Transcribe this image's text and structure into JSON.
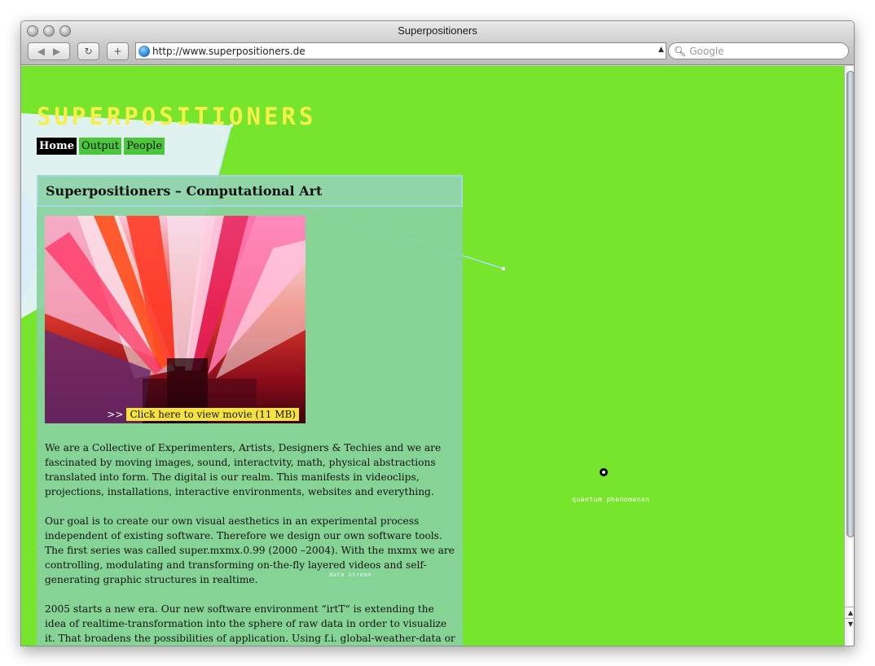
{
  "window": {
    "title": "Superpositioners"
  },
  "toolbar": {
    "back_icon": "back-arrow-icon",
    "forward_icon": "forward-arrow-icon",
    "reload_symbol": "↻",
    "add_symbol": "+",
    "url": "http://www.superpositioners.de",
    "search_placeholder": "Google"
  },
  "page": {
    "logo": "SUPERPOSITIONERS",
    "nav": [
      {
        "label": "Home",
        "active": true
      },
      {
        "label": "Output",
        "active": false
      },
      {
        "label": "People",
        "active": false
      }
    ],
    "panel_title": "Superpositioners – Computational Art",
    "movie_arrows": ">>",
    "movie_link": "Click here to view movie (11 MB)",
    "paragraphs": [
      "We are a Collective of Experimenters, Artists, Designers & Techies and we are fascinated by moving images, sound, interactvity, math, physical abstractions translated into form. The digital is our realm. This manifests in videoclips, projections, installations, interactive environments, websites and everything.",
      "Our goal is to create our own visual aesthetics in an experimental process independent of existing software. Therefore we design our own software tools. The first series was called super.mxmx.0.99 (2000 –2004). With the mxmx we are controlling, modulating and transforming on-the-fly layered videos and self-generating graphic structures in realtime.",
      "2005 starts a new era. Our new software environment “irtT“ is extending the idea of realtime-transformation into the sphere of raw data in order to visualize it. That broadens the possibilities of application. Using f.i. global-weather-data or the"
    ],
    "phenomenon_label": "quantum phenomenon",
    "small_label": "data stream"
  },
  "colors": {
    "page_background": "#77e52c",
    "logo": "#f5f04a",
    "nav_active_bg": "#000000",
    "nav_bg": "#4cc63b",
    "movie_button": "#f6e23c"
  }
}
